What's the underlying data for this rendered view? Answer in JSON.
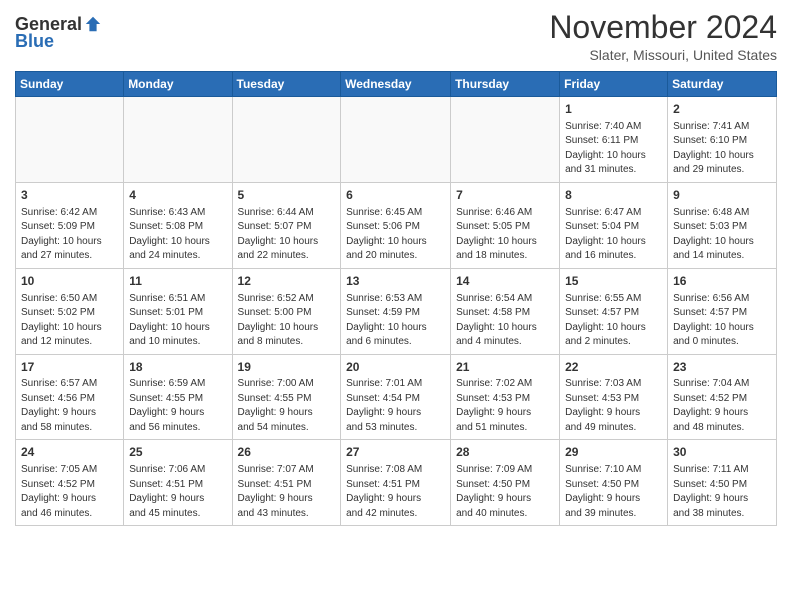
{
  "logo": {
    "general": "General",
    "blue": "Blue"
  },
  "header": {
    "month": "November 2024",
    "location": "Slater, Missouri, United States"
  },
  "weekdays": [
    "Sunday",
    "Monday",
    "Tuesday",
    "Wednesday",
    "Thursday",
    "Friday",
    "Saturday"
  ],
  "weeks": [
    [
      {
        "day": "",
        "info": ""
      },
      {
        "day": "",
        "info": ""
      },
      {
        "day": "",
        "info": ""
      },
      {
        "day": "",
        "info": ""
      },
      {
        "day": "",
        "info": ""
      },
      {
        "day": "1",
        "info": "Sunrise: 7:40 AM\nSunset: 6:11 PM\nDaylight: 10 hours\nand 31 minutes."
      },
      {
        "day": "2",
        "info": "Sunrise: 7:41 AM\nSunset: 6:10 PM\nDaylight: 10 hours\nand 29 minutes."
      }
    ],
    [
      {
        "day": "3",
        "info": "Sunrise: 6:42 AM\nSunset: 5:09 PM\nDaylight: 10 hours\nand 27 minutes."
      },
      {
        "day": "4",
        "info": "Sunrise: 6:43 AM\nSunset: 5:08 PM\nDaylight: 10 hours\nand 24 minutes."
      },
      {
        "day": "5",
        "info": "Sunrise: 6:44 AM\nSunset: 5:07 PM\nDaylight: 10 hours\nand 22 minutes."
      },
      {
        "day": "6",
        "info": "Sunrise: 6:45 AM\nSunset: 5:06 PM\nDaylight: 10 hours\nand 20 minutes."
      },
      {
        "day": "7",
        "info": "Sunrise: 6:46 AM\nSunset: 5:05 PM\nDaylight: 10 hours\nand 18 minutes."
      },
      {
        "day": "8",
        "info": "Sunrise: 6:47 AM\nSunset: 5:04 PM\nDaylight: 10 hours\nand 16 minutes."
      },
      {
        "day": "9",
        "info": "Sunrise: 6:48 AM\nSunset: 5:03 PM\nDaylight: 10 hours\nand 14 minutes."
      }
    ],
    [
      {
        "day": "10",
        "info": "Sunrise: 6:50 AM\nSunset: 5:02 PM\nDaylight: 10 hours\nand 12 minutes."
      },
      {
        "day": "11",
        "info": "Sunrise: 6:51 AM\nSunset: 5:01 PM\nDaylight: 10 hours\nand 10 minutes."
      },
      {
        "day": "12",
        "info": "Sunrise: 6:52 AM\nSunset: 5:00 PM\nDaylight: 10 hours\nand 8 minutes."
      },
      {
        "day": "13",
        "info": "Sunrise: 6:53 AM\nSunset: 4:59 PM\nDaylight: 10 hours\nand 6 minutes."
      },
      {
        "day": "14",
        "info": "Sunrise: 6:54 AM\nSunset: 4:58 PM\nDaylight: 10 hours\nand 4 minutes."
      },
      {
        "day": "15",
        "info": "Sunrise: 6:55 AM\nSunset: 4:57 PM\nDaylight: 10 hours\nand 2 minutes."
      },
      {
        "day": "16",
        "info": "Sunrise: 6:56 AM\nSunset: 4:57 PM\nDaylight: 10 hours\nand 0 minutes."
      }
    ],
    [
      {
        "day": "17",
        "info": "Sunrise: 6:57 AM\nSunset: 4:56 PM\nDaylight: 9 hours\nand 58 minutes."
      },
      {
        "day": "18",
        "info": "Sunrise: 6:59 AM\nSunset: 4:55 PM\nDaylight: 9 hours\nand 56 minutes."
      },
      {
        "day": "19",
        "info": "Sunrise: 7:00 AM\nSunset: 4:55 PM\nDaylight: 9 hours\nand 54 minutes."
      },
      {
        "day": "20",
        "info": "Sunrise: 7:01 AM\nSunset: 4:54 PM\nDaylight: 9 hours\nand 53 minutes."
      },
      {
        "day": "21",
        "info": "Sunrise: 7:02 AM\nSunset: 4:53 PM\nDaylight: 9 hours\nand 51 minutes."
      },
      {
        "day": "22",
        "info": "Sunrise: 7:03 AM\nSunset: 4:53 PM\nDaylight: 9 hours\nand 49 minutes."
      },
      {
        "day": "23",
        "info": "Sunrise: 7:04 AM\nSunset: 4:52 PM\nDaylight: 9 hours\nand 48 minutes."
      }
    ],
    [
      {
        "day": "24",
        "info": "Sunrise: 7:05 AM\nSunset: 4:52 PM\nDaylight: 9 hours\nand 46 minutes."
      },
      {
        "day": "25",
        "info": "Sunrise: 7:06 AM\nSunset: 4:51 PM\nDaylight: 9 hours\nand 45 minutes."
      },
      {
        "day": "26",
        "info": "Sunrise: 7:07 AM\nSunset: 4:51 PM\nDaylight: 9 hours\nand 43 minutes."
      },
      {
        "day": "27",
        "info": "Sunrise: 7:08 AM\nSunset: 4:51 PM\nDaylight: 9 hours\nand 42 minutes."
      },
      {
        "day": "28",
        "info": "Sunrise: 7:09 AM\nSunset: 4:50 PM\nDaylight: 9 hours\nand 40 minutes."
      },
      {
        "day": "29",
        "info": "Sunrise: 7:10 AM\nSunset: 4:50 PM\nDaylight: 9 hours\nand 39 minutes."
      },
      {
        "day": "30",
        "info": "Sunrise: 7:11 AM\nSunset: 4:50 PM\nDaylight: 9 hours\nand 38 minutes."
      }
    ]
  ]
}
